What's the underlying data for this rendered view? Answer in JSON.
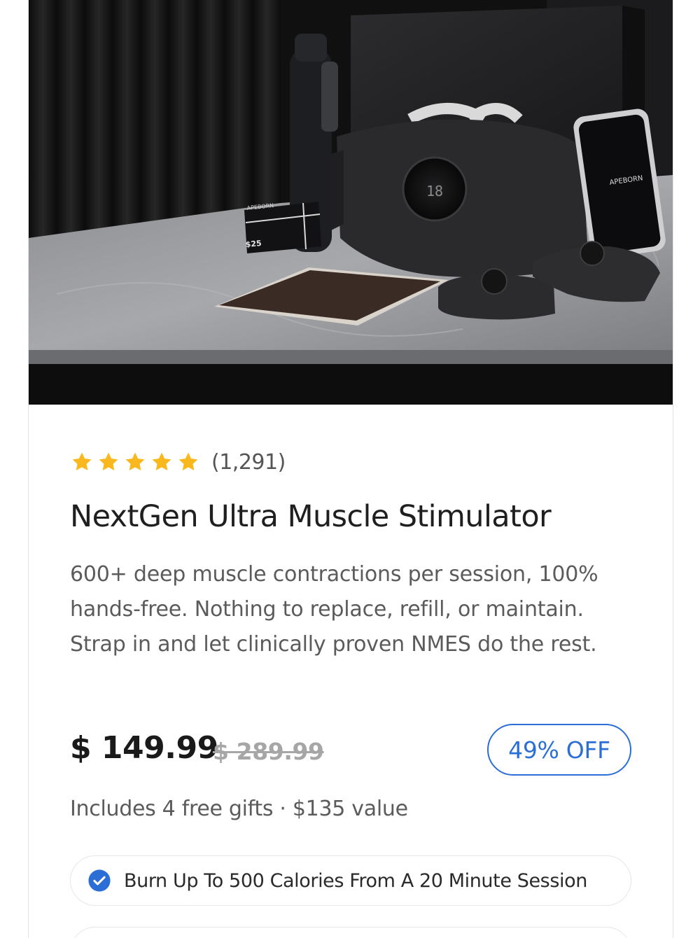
{
  "product": {
    "rating": 5,
    "review_count": "(1,291)",
    "title": "NextGen Ultra Muscle Stimulator",
    "description": "600+ deep muscle contractions per session, 100% hands-free. Nothing to replace, refill, or maintain. Strap in and let clinically proven NMES do the rest.",
    "price": "$ 149.99",
    "compare_price": "$ 289.99",
    "discount": "49% OFF",
    "gifts_note": "Includes 4 free gifts · $135 value"
  },
  "hero_image": {
    "brand_text": "APEBORN",
    "gift_card_value": "$25",
    "device_display": "18"
  },
  "benefits": [
    {
      "label": "Burn Up To 500 Calories From A 20 Minute Session",
      "icon": "check-circle-icon"
    }
  ],
  "colors": {
    "star": "#F9B81E",
    "accent": "#2B6FD6",
    "title": "#1F1F1F",
    "body_text": "#5B5B5B",
    "strike_price": "#A6A6A6"
  }
}
